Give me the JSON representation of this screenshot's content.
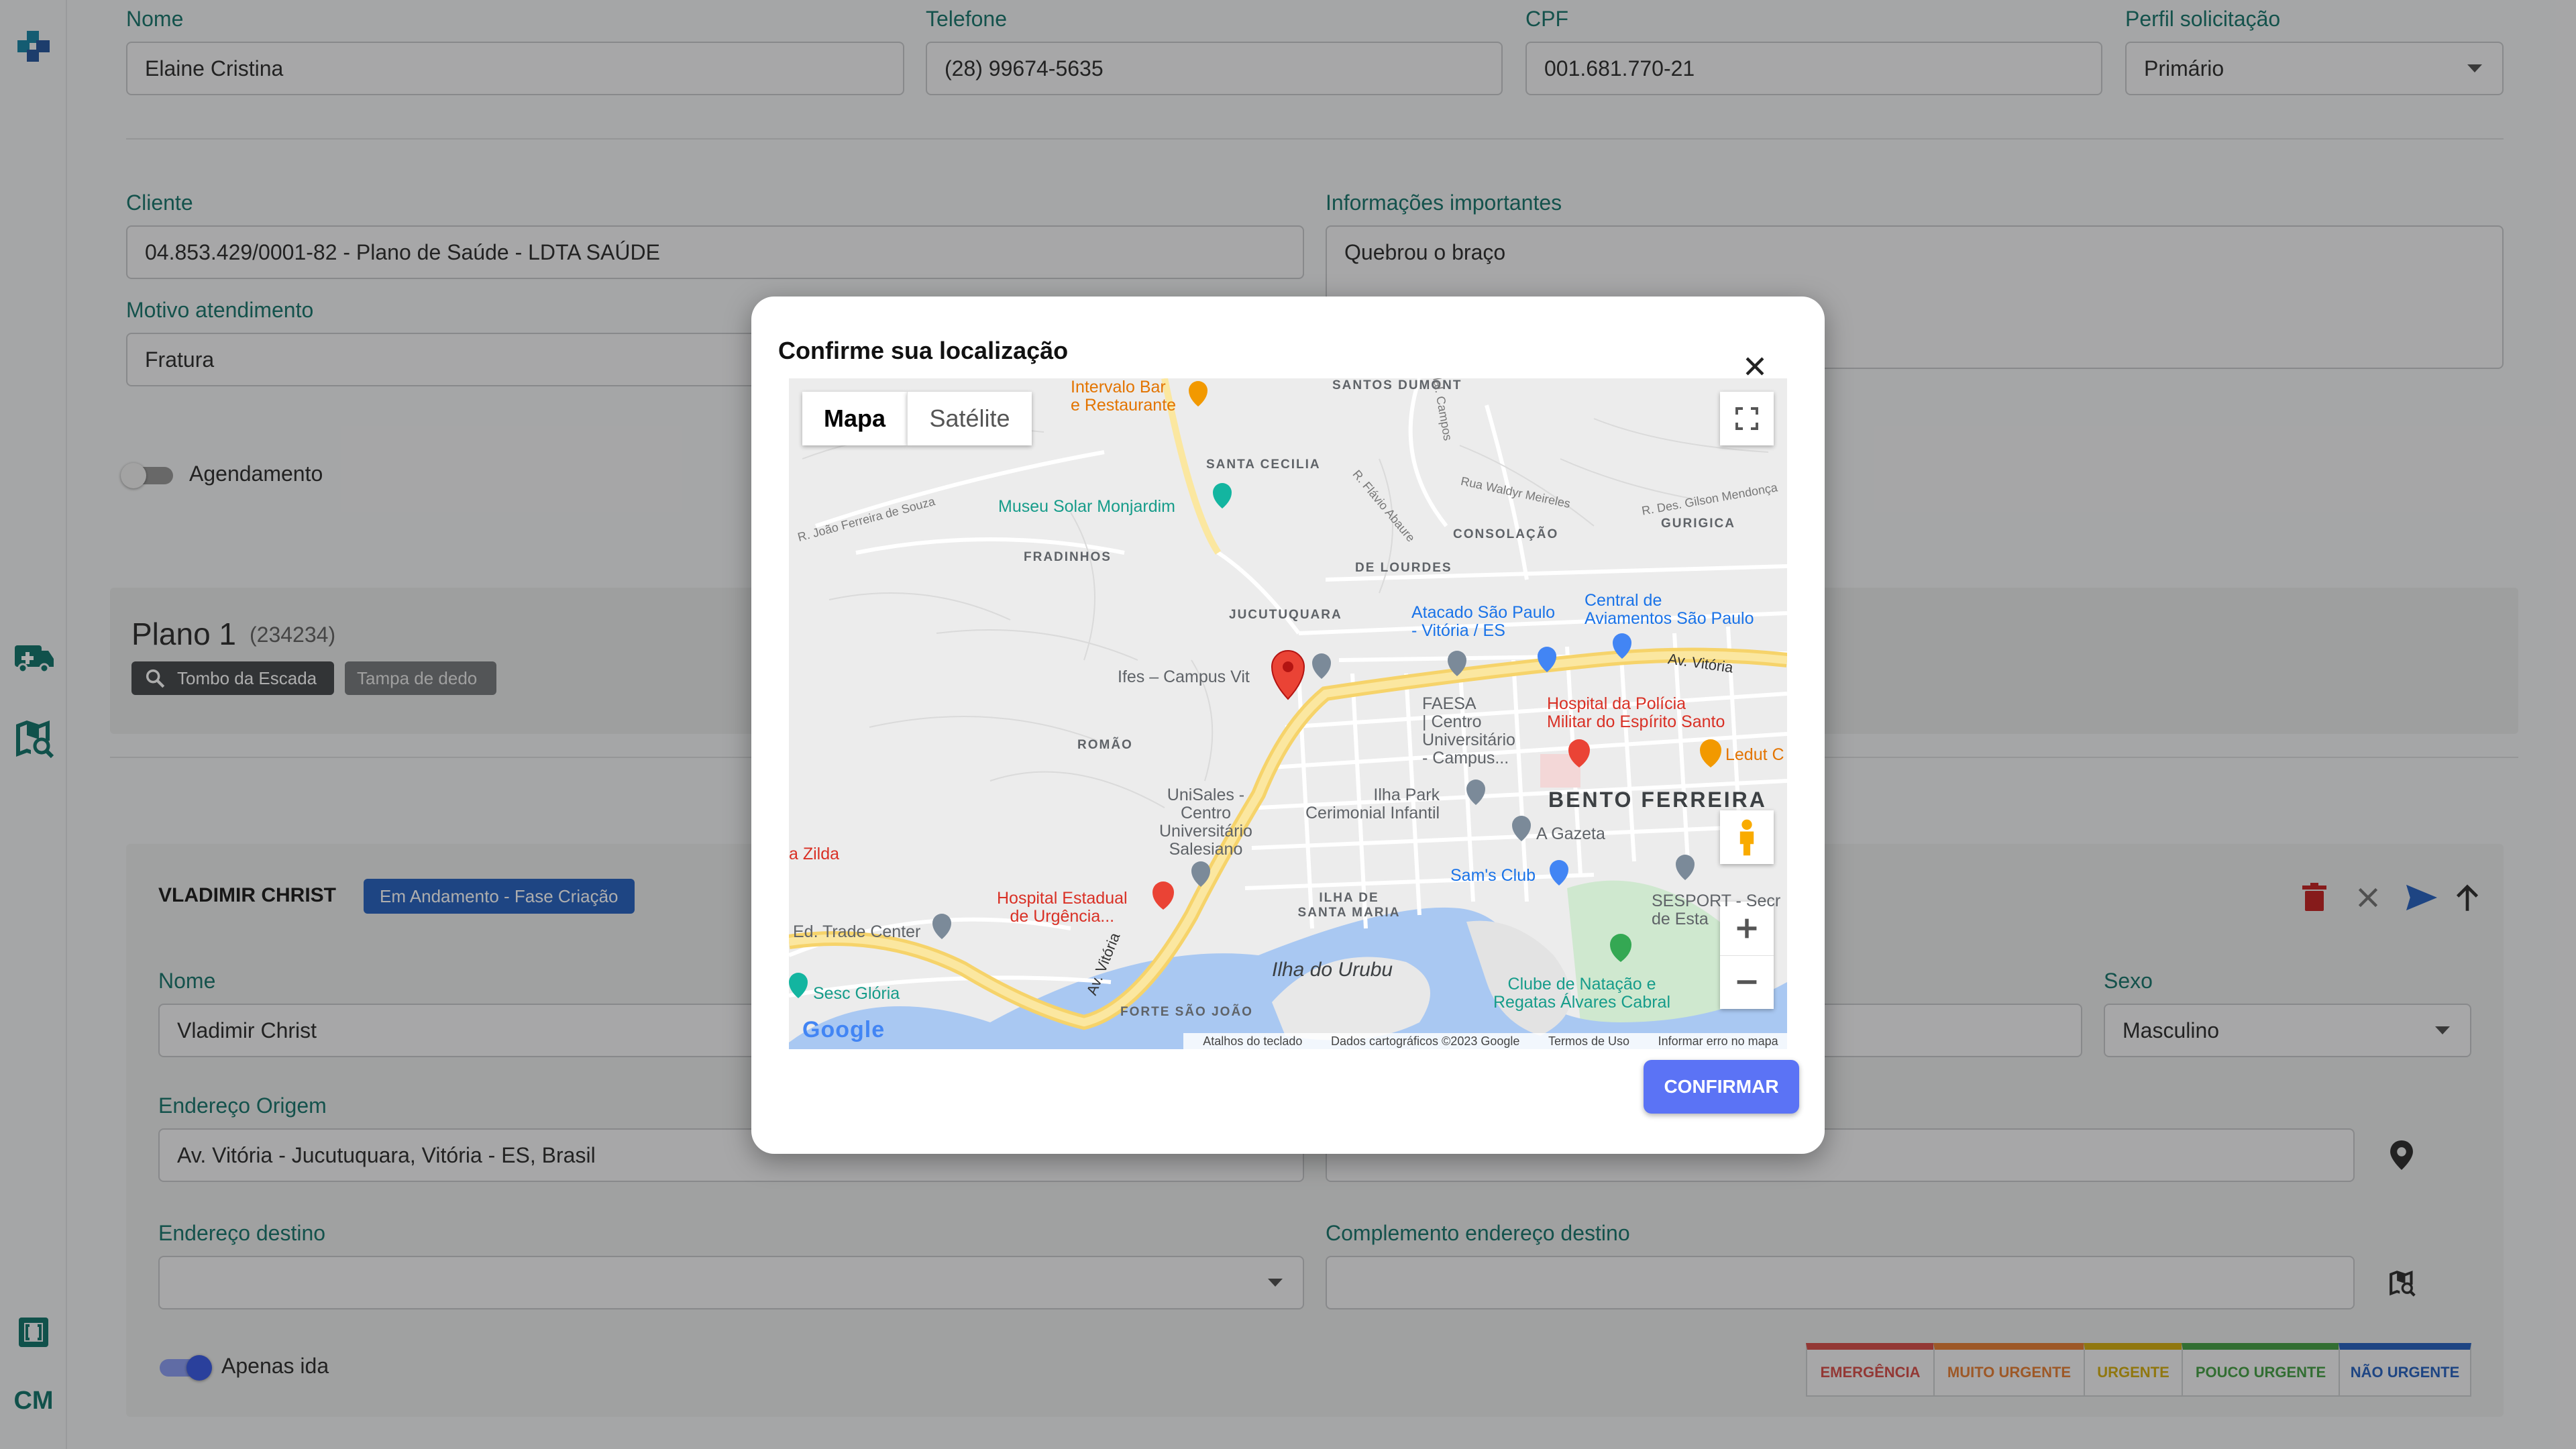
{
  "form": {
    "nome_label": "Nome",
    "nome_value": "Elaine Cristina",
    "telefone_label": "Telefone",
    "telefone_value": "(28) 99674-5635",
    "cpf_label": "CPF",
    "cpf_value": "001.681.770-21",
    "perfil_label": "Perfil solicitação",
    "perfil_value": "Primário",
    "cliente_label": "Cliente",
    "cliente_value": "04.853.429/0001-82 - Plano de Saúde - LDTA SAÚDE",
    "info_label": "Informações importantes",
    "info_value": "Quebrou o braço",
    "motivo_label": "Motivo atendimento",
    "motivo_value": "Fratura",
    "agendamento_label": "Agendamento"
  },
  "plano": {
    "title": "Plano 1",
    "code": "(234234)",
    "chips": [
      "Tombo da Escada",
      "Tampa de dedo"
    ]
  },
  "patient": {
    "name": "VLADIMIR CHRIST",
    "status": "Em Andamento - Fase Criação",
    "nome_label": "Nome",
    "nome_value": "Vladimir Christ",
    "sexo_label": "Sexo",
    "sexo_value": "Masculino",
    "origem_label": "Endereço Origem",
    "origem_value": "Av. Vitória - Jucutuquara, Vitória - ES, Brasil",
    "destino_label": "Endereço destino",
    "destino_value": "",
    "complemento_label": "Complemento endereço destino",
    "complemento_value": "",
    "apenas_ida_label": "Apenas ida"
  },
  "priority": [
    {
      "label": "EMERGÊNCIA",
      "color": "#d9534f"
    },
    {
      "label": "MUITO URGENTE",
      "color": "#e8823a"
    },
    {
      "label": "URGENTE",
      "color": "#d4b017"
    },
    {
      "label": "POUCO URGENTE",
      "color": "#4aa34a"
    },
    {
      "label": "NÃO URGENTE",
      "color": "#2d66c2"
    }
  ],
  "sidebar": {
    "cm_label": "CM"
  },
  "modal": {
    "title": "Confirme sua localização",
    "confirm_label": "CONFIRMAR",
    "map": {
      "type_buttons": [
        "Mapa",
        "Satélite"
      ],
      "areas": [
        "SANTOS DUMONT",
        "SANTA CECILIA",
        "FRADINHOS",
        "DE LOURDES",
        "CONSOLAÇÃO",
        "GURIGICA",
        "JUCUTUQUARA",
        "ROMÃO",
        "ILHA DE SANTA MARIA",
        "FORTE SÃO JOÃO",
        "BENTO FERREIRA"
      ],
      "streets": [
        "R. João Ferreira de Souza",
        "R. Flávio Abaure",
        "Mal. Campos",
        "Rua Waldyr Meireles",
        "R. Des. Gilson Mendonça",
        "Av. Vitória",
        "Av. Vitória"
      ],
      "pois": {
        "intervalo": "Intervalo Bar\ne Restaurante",
        "museu": "Museu Solar Monjardim",
        "atacado": "Atacado São Paulo\n- Vitória / ES",
        "central": "Central de\nAviamentos São Paulo",
        "ifes": "Ifes – Campus Vit",
        "faesa": "FAESA\n| Centro\nUniversitário\n- Campus...",
        "hospital_policia": "Hospital da Polícia\nMilitar do Espírito Santo",
        "ledut": "Ledut C",
        "unisales": "UniSales -\nCentro\nUniversitário\nSalesiano",
        "ilha_park": "Ilha Park\nCerimonial Infantil",
        "gazeta": "A Gazeta",
        "sams": "Sam's Club",
        "sesport": "SESPORT - Secr\nde Esta",
        "zilda": "a Zilda",
        "hospital_estadual": "Hospital Estadual\nde Urgência...",
        "trade": "Ed. Trade Center",
        "sesc": "Sesc Glória",
        "ilha_urubu": "Ilha do Urubu",
        "clube": "Clube de Natação e\nRegatas Álvares Cabral"
      },
      "attribution": [
        "Atalhos do teclado",
        "Dados cartográficos ©2023 Google",
        "Termos de Uso",
        "Informar erro no mapa"
      ],
      "logo": "Google"
    }
  }
}
